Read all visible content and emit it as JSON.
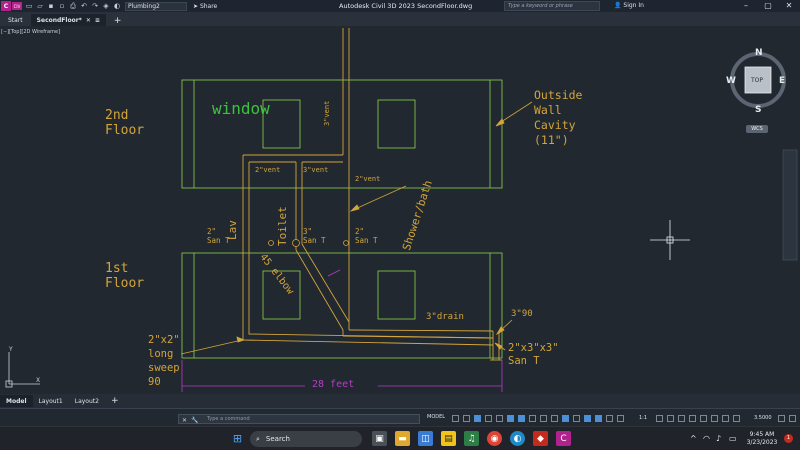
{
  "window": {
    "app_badge": "C",
    "app_badge2": "CIV",
    "workspace": "Plumbing2",
    "share_label": "Share",
    "title": "Autodesk Civil 3D 2023    SecondFloor.dwg",
    "search_placeholder": "Type a keyword or phrase",
    "signin_label": "Sign In"
  },
  "tabs": [
    {
      "label": "Start"
    },
    {
      "label": "SecondFloor*"
    }
  ],
  "viewport_label": "[−][Top][2D Wireframe]",
  "viewcube": {
    "north": "N",
    "south": "S",
    "east": "E",
    "west": "W",
    "face": "TOP",
    "wcs": "WCS"
  },
  "drawing_labels": {
    "floor2": [
      "2nd",
      "Floor"
    ],
    "floor1": [
      "1st",
      "Floor"
    ],
    "window": "window",
    "vent_top": "3\"vent",
    "outside_wall": [
      "Outside",
      "Wall",
      "Cavity",
      "(11\")"
    ],
    "vent_2a": "2\"vent",
    "vent_3": "3\"vent",
    "vent_2b": "2\"vent",
    "shower_bath": "Shower/bath",
    "lav": "Lav",
    "toilet": "Toilet",
    "san_t_left": [
      "2\"",
      "San T"
    ],
    "san_t_mid": [
      "3\"",
      "San T"
    ],
    "san_t_right": [
      "2\"",
      "San T"
    ],
    "elbow": "45 elbow",
    "drain": "3\"drain",
    "ninety": "3\"90",
    "long_sweep": [
      "2\"x2\"",
      "long",
      "sweep",
      "90"
    ],
    "san_t_big": [
      "2\"x3\"x3\"",
      "San T"
    ],
    "dimension": "28 feet"
  },
  "layout_tabs": [
    {
      "label": "Model"
    },
    {
      "label": "Layout1"
    },
    {
      "label": "Layout2"
    }
  ],
  "command_placeholder": "Type a command",
  "status": {
    "model": "MODEL",
    "scale": "1:1",
    "unit_value": "3.5000"
  },
  "taskbar": {
    "search_label": "Search",
    "time": "9:45 AM",
    "date": "3/23/2023",
    "notifications": "1"
  },
  "colors": {
    "pipe": "#d4a53a",
    "wall": "#8fd14f",
    "text": "#d4a53a",
    "window_text": "#3cc23c",
    "dimension": "#b63dc4",
    "background": "#212830"
  }
}
